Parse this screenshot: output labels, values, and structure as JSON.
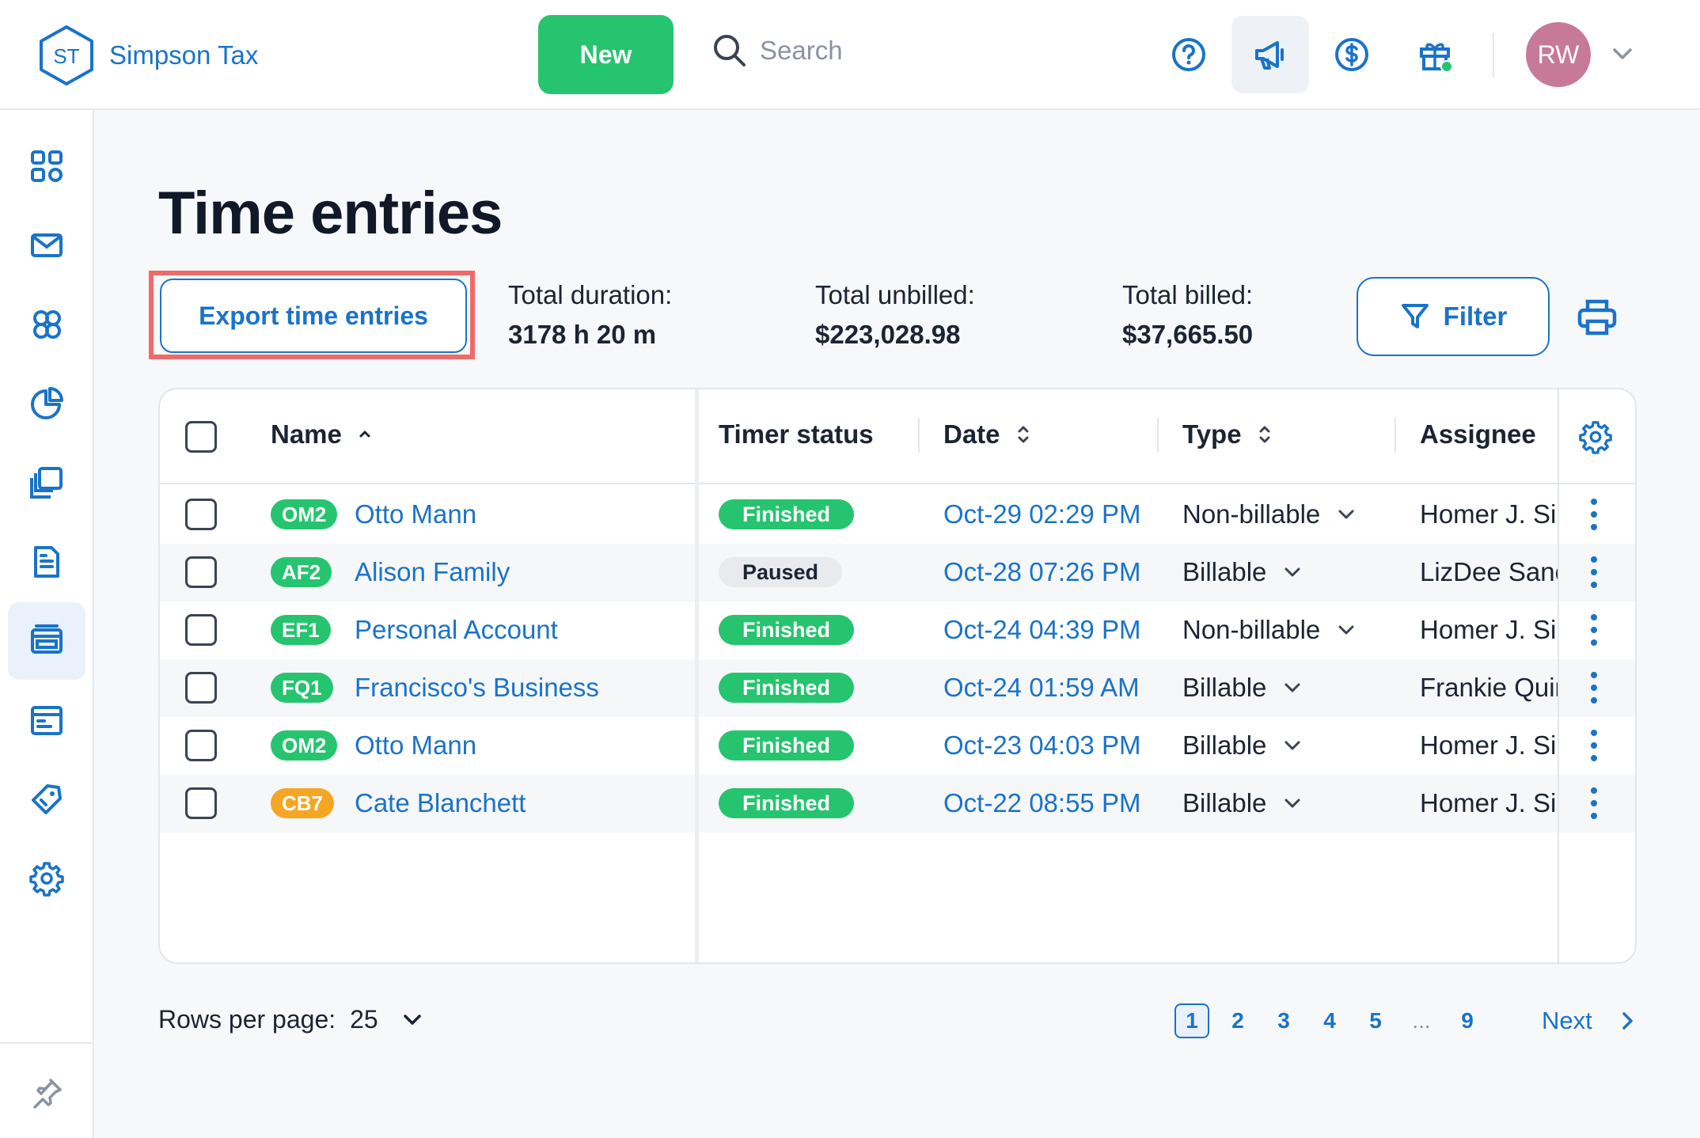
{
  "brand": {
    "initials": "ST",
    "name": "Simpson Tax"
  },
  "header": {
    "new_label": "New",
    "search_placeholder": "Search",
    "avatar_initials": "RW",
    "icons": [
      "help-icon",
      "megaphone-icon",
      "dollar-icon",
      "gift-icon"
    ]
  },
  "sidebar": {
    "items": [
      "dashboard-icon",
      "mail-icon",
      "contacts-icon",
      "reports-icon",
      "documents-icon",
      "invoice-icon",
      "time-entries-icon",
      "calendar-icon",
      "tags-icon",
      "settings-icon"
    ],
    "active": "time-entries-icon",
    "bottom": "pin-icon"
  },
  "page": {
    "title": "Time entries",
    "export_label": "Export time entries",
    "stats": [
      {
        "label": "Total duration:",
        "value": "3178 h 20 m"
      },
      {
        "label": "Total unbilled:",
        "value": "$223,028.98"
      },
      {
        "label": "Total billed:",
        "value": "$37,665.50"
      }
    ],
    "filter_label": "Filter"
  },
  "table": {
    "columns": {
      "name": "Name",
      "timer_status": "Timer status",
      "date": "Date",
      "type": "Type",
      "assignee": "Assignee"
    },
    "rows": [
      {
        "tag": "OM2",
        "tag_color": "#26c46f",
        "name": "Otto Mann",
        "status": "Finished",
        "date": "Oct-29 02:29 PM",
        "type": "Non-billable",
        "assignee": "Homer J. Simpson"
      },
      {
        "tag": "AF2",
        "tag_color": "#26c46f",
        "name": "Alison Family",
        "status": "Paused",
        "date": "Oct-28 07:26 PM",
        "type": "Billable",
        "assignee": "LizDee Sanchez"
      },
      {
        "tag": "EF1",
        "tag_color": "#26c46f",
        "name": "Personal Account",
        "status": "Finished",
        "date": "Oct-24 04:39 PM",
        "type": "Non-billable",
        "assignee": "Homer J. Simpson"
      },
      {
        "tag": "FQ1",
        "tag_color": "#26c46f",
        "name": "Francisco's Business",
        "status": "Finished",
        "date": "Oct-24 01:59 AM",
        "type": "Billable",
        "assignee": "Frankie Quinn"
      },
      {
        "tag": "OM2",
        "tag_color": "#26c46f",
        "name": "Otto Mann",
        "status": "Finished",
        "date": "Oct-23 04:03 PM",
        "type": "Billable",
        "assignee": "Homer J. Simpson"
      },
      {
        "tag": "CB7",
        "tag_color": "#f5a623",
        "name": "Cate Blanchett",
        "status": "Finished",
        "date": "Oct-22 08:55 PM",
        "type": "Billable",
        "assignee": "Homer J. Simpson"
      }
    ]
  },
  "footer": {
    "rows_per_page_label": "Rows per page:",
    "rows_per_page_value": "25",
    "pages": [
      "1",
      "2",
      "3",
      "4",
      "5",
      "...",
      "9"
    ],
    "current_page": "1",
    "next_label": "Next"
  },
  "colors": {
    "accent": "#1a73c8",
    "success": "#26c46f",
    "warning": "#f5a623",
    "highlight": "#f06a6a"
  }
}
